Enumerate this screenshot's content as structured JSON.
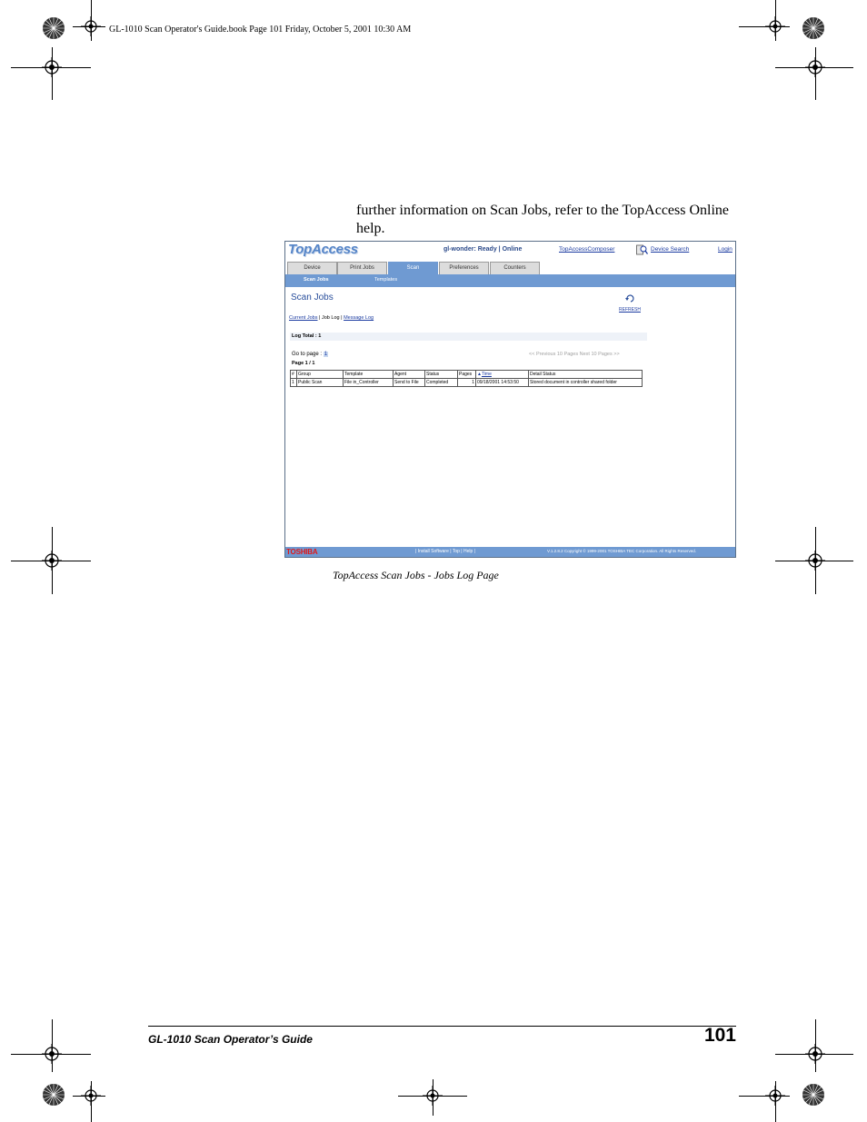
{
  "print_header": "GL-1010 Scan Operator's Guide.book  Page 101  Friday, October 5, 2001  10:30 AM",
  "body_text": "further information on Scan Jobs, refer to the TopAccess Online help.",
  "screenshot": {
    "logo": "TopAccess",
    "status": "gl-wonder: Ready | Online",
    "top_links": {
      "composer": "TopAccessComposer",
      "device_search": "Device Search",
      "login": "Login"
    },
    "tabs": [
      {
        "label": "Device",
        "active": false
      },
      {
        "label": "Print Jobs",
        "active": false
      },
      {
        "label": "Scan",
        "active": true
      },
      {
        "label": "Preferences",
        "active": false
      },
      {
        "label": "Counters",
        "active": false
      }
    ],
    "subnav": [
      "Scan Jobs",
      "Templates"
    ],
    "page_title": "Scan Jobs",
    "refresh_label": "REFRESH",
    "links": {
      "current_jobs": "Current Jobs",
      "sep1": " | ",
      "job_log": "Job Log",
      "sep2": " | ",
      "message_log": "Message Log"
    },
    "log_total": "Log Total : 1",
    "goto_label": "Go to page : ",
    "goto_page": "1",
    "page_nav": "<< Previous 10 Pages    Next 10 Pages >>",
    "page_info": "Page 1 / 1",
    "table": {
      "headers": [
        "#",
        "Group",
        "Template",
        "Agent",
        "Status",
        "Pages",
        "Time",
        "Detail Status"
      ],
      "rows": [
        [
          "1",
          "Public Scan",
          "File in_Controller",
          "Send to File",
          "Completed",
          "1",
          "09/18/2001 14:53:50",
          "Stored document in controller shared folder"
        ]
      ]
    },
    "footer": {
      "brand": "TOSHIBA",
      "links": "|  Install Software  |   Top   |   Help   |",
      "copyright": "V.1.2.8.2   Copyright © 1999-2001 TOSHIBA TEC Corporation. All Rights Reserved."
    }
  },
  "caption": "TopAccess Scan Jobs - Jobs Log Page",
  "footer": {
    "title": "GL-1010 Scan Operator’s Guide",
    "page_number": "101"
  }
}
